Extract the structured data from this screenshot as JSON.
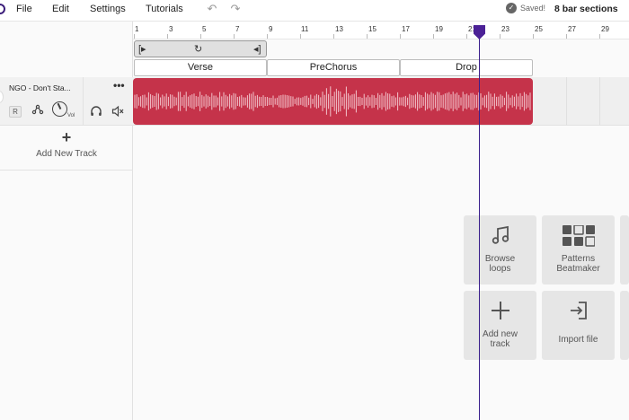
{
  "menu": {
    "file": "File",
    "edit": "Edit",
    "settings": "Settings",
    "tutorials": "Tutorials"
  },
  "status": {
    "saved": "Saved!",
    "bar_sections": "8 bar sections"
  },
  "ruler": {
    "ticks": [
      "1",
      "3",
      "5",
      "7",
      "9",
      "11",
      "13",
      "15",
      "17",
      "19",
      "21",
      "23",
      "25",
      "27",
      "29"
    ]
  },
  "sections": [
    "Verse",
    "PreChorus",
    "Drop"
  ],
  "track": {
    "name": "NGO - Don't Sta...",
    "record": "R",
    "vol_label": "Vol",
    "clip_color": "#c5334a"
  },
  "add_track": {
    "label": "Add New Track"
  },
  "tiles": {
    "browse_loops": {
      "line1": "Browse",
      "line2": "loops"
    },
    "patterns": {
      "line1": "Patterns",
      "line2": "Beatmaker"
    },
    "add_new_track": {
      "line1": "Add new",
      "line2": "track"
    },
    "import_file": {
      "line1": "Import file"
    }
  },
  "colors": {
    "playhead": "#4b2196",
    "clip": "#c5334a",
    "tile_bg": "#e6e6e6"
  }
}
